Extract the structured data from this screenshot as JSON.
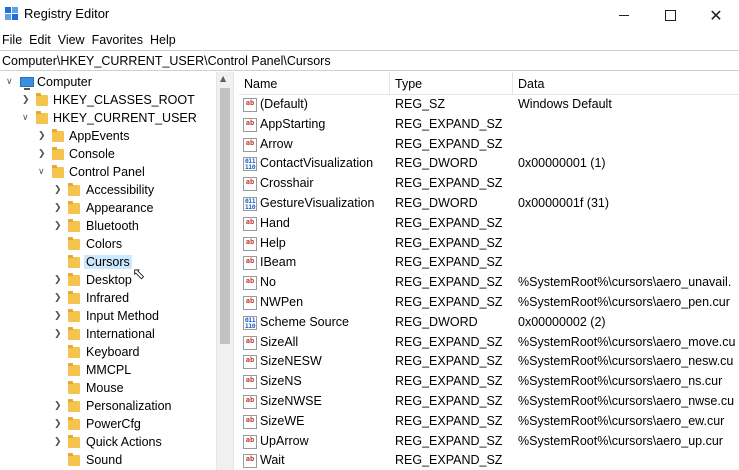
{
  "window": {
    "title": "Registry Editor",
    "controls": {
      "minimize": "—",
      "maximize": "□",
      "close": "✕"
    }
  },
  "menu": [
    "File",
    "Edit",
    "View",
    "Favorites",
    "Help"
  ],
  "address": "Computer\\HKEY_CURRENT_USER\\Control Panel\\Cursors",
  "tree": {
    "root": "Computer",
    "hkcr": "HKEY_CLASSES_ROOT",
    "hkcu": "HKEY_CURRENT_USER",
    "hkcu_children": [
      "AppEvents",
      "Console",
      "Control Panel"
    ],
    "control_panel_children": [
      "Accessibility",
      "Appearance",
      "Bluetooth",
      "Colors",
      "Cursors",
      "Desktop",
      "Infrared",
      "Input Method",
      "International",
      "Keyboard",
      "MMCPL",
      "Mouse",
      "Personalization",
      "PowerCfg",
      "Quick Actions",
      "Sound"
    ],
    "selected": "Cursors"
  },
  "list": {
    "columns": {
      "name": "Name",
      "type": "Type",
      "data": "Data"
    },
    "rows": [
      {
        "name": "(Default)",
        "type": "REG_SZ",
        "data": "Windows Default"
      },
      {
        "name": "AppStarting",
        "type": "REG_EXPAND_SZ",
        "data": ""
      },
      {
        "name": "Arrow",
        "type": "REG_EXPAND_SZ",
        "data": ""
      },
      {
        "name": "ContactVisualization",
        "type": "REG_DWORD",
        "data": "0x00000001 (1)"
      },
      {
        "name": "Crosshair",
        "type": "REG_EXPAND_SZ",
        "data": ""
      },
      {
        "name": "GestureVisualization",
        "type": "REG_DWORD",
        "data": "0x0000001f (31)"
      },
      {
        "name": "Hand",
        "type": "REG_EXPAND_SZ",
        "data": ""
      },
      {
        "name": "Help",
        "type": "REG_EXPAND_SZ",
        "data": ""
      },
      {
        "name": "IBeam",
        "type": "REG_EXPAND_SZ",
        "data": ""
      },
      {
        "name": "No",
        "type": "REG_EXPAND_SZ",
        "data": "%SystemRoot%\\cursors\\aero_unavail."
      },
      {
        "name": "NWPen",
        "type": "REG_EXPAND_SZ",
        "data": "%SystemRoot%\\cursors\\aero_pen.cur"
      },
      {
        "name": "Scheme Source",
        "type": "REG_DWORD",
        "data": "0x00000002 (2)"
      },
      {
        "name": "SizeAll",
        "type": "REG_EXPAND_SZ",
        "data": "%SystemRoot%\\cursors\\aero_move.cu"
      },
      {
        "name": "SizeNESW",
        "type": "REG_EXPAND_SZ",
        "data": "%SystemRoot%\\cursors\\aero_nesw.cu"
      },
      {
        "name": "SizeNS",
        "type": "REG_EXPAND_SZ",
        "data": "%SystemRoot%\\cursors\\aero_ns.cur"
      },
      {
        "name": "SizeNWSE",
        "type": "REG_EXPAND_SZ",
        "data": "%SystemRoot%\\cursors\\aero_nwse.cu"
      },
      {
        "name": "SizeWE",
        "type": "REG_EXPAND_SZ",
        "data": "%SystemRoot%\\cursors\\aero_ew.cur"
      },
      {
        "name": "UpArrow",
        "type": "REG_EXPAND_SZ",
        "data": "%SystemRoot%\\cursors\\aero_up.cur"
      },
      {
        "name": "Wait",
        "type": "REG_EXPAND_SZ",
        "data": ""
      }
    ]
  },
  "colors": {
    "selection": "#cce8ff",
    "folder": "#f4c44e",
    "sz_icon": "#c0392b",
    "dword_icon": "#1d5fc2"
  },
  "icons": {
    "app": "registry-editor-icon",
    "tree_folder": "folder-icon",
    "tree_root": "computer-icon",
    "value_sz": "string-value-icon",
    "value_dword": "binary-value-icon"
  }
}
